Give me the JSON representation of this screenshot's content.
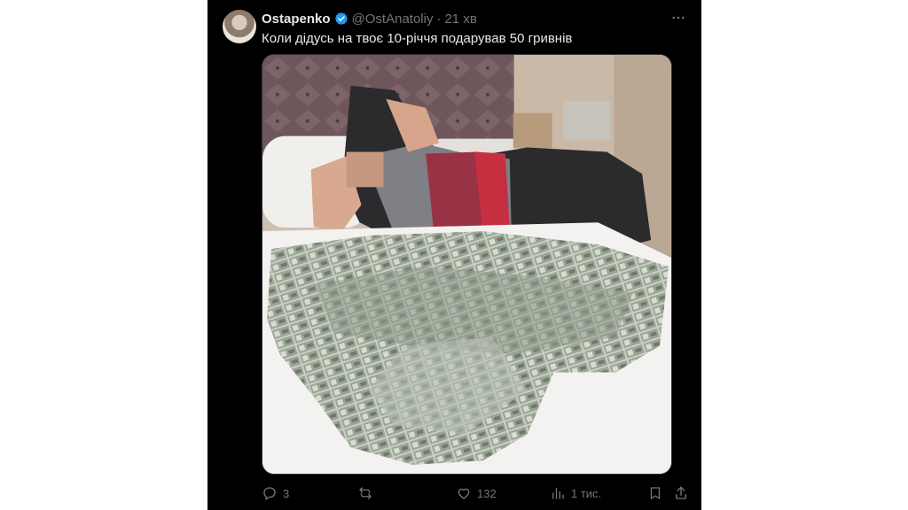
{
  "tweet": {
    "author_name": "Ostapenko",
    "handle": "@OstAnatoliy",
    "separator": "·",
    "time": "21 хв",
    "text": "Коли дідусь на твоє 10-річчя подарував 50 гривнів"
  },
  "actions": {
    "replies": "3",
    "likes": "132",
    "views": "1 тис."
  },
  "icons": {
    "verified": "verified-badge-icon",
    "more": "more-icon",
    "reply": "reply-icon",
    "retweet": "retweet-icon",
    "like": "heart-icon",
    "views": "views-icon",
    "bookmark": "bookmark-icon",
    "share": "share-icon"
  },
  "colors": {
    "background": "#000000",
    "text": "#e7e9ea",
    "muted": "#71767b",
    "verified": "#1d9bf0"
  }
}
